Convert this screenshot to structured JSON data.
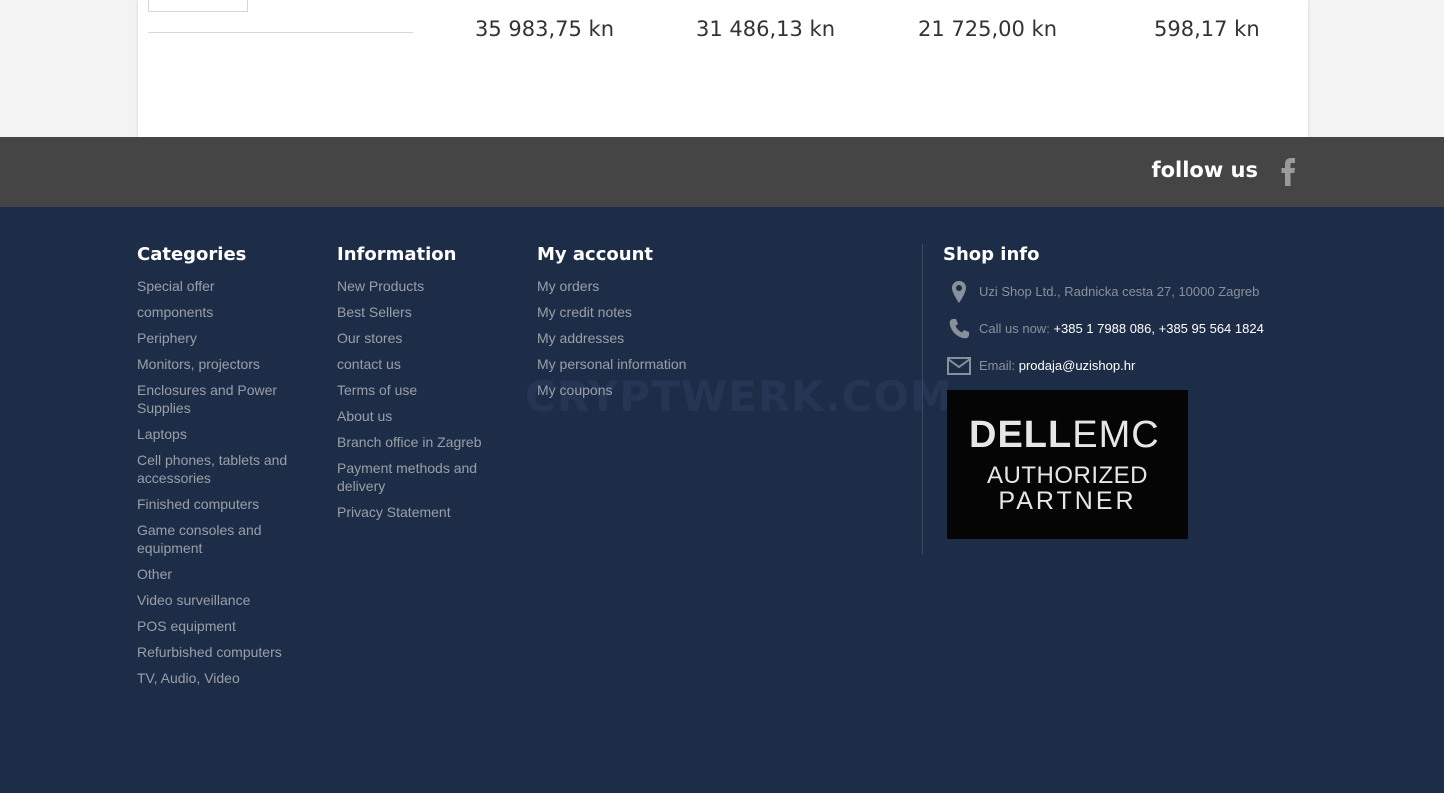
{
  "prices": [
    "35 983,75 kn",
    "31 486,13 kn",
    "21 725,00 kn",
    "598,17 kn"
  ],
  "follow": {
    "label": "follow us",
    "icon": "facebook-icon"
  },
  "footer": {
    "categories": {
      "title": "Categories",
      "items": [
        "Special offer",
        "components",
        "Periphery",
        "Monitors, projectors",
        "Enclosures and Power Supplies",
        "Laptops",
        "Cell phones, tablets and accessories",
        "Finished computers",
        "Game consoles and equipment",
        "Other",
        "Video surveillance",
        "POS equipment",
        "Refurbished computers",
        "TV, Audio, Video"
      ]
    },
    "information": {
      "title": "Information",
      "items": [
        "New Products",
        "Best Sellers",
        "Our stores",
        "contact us",
        "Terms of use",
        "About us",
        "Branch office in Zagreb",
        "Payment methods and delivery",
        "Privacy Statement"
      ]
    },
    "account": {
      "title": "My account",
      "items": [
        "My orders",
        "My credit notes",
        "My addresses",
        "My personal information",
        "My coupons"
      ]
    },
    "shop_info": {
      "title": "Shop info",
      "address": "Uzi Shop Ltd., Radnicka cesta 27, 10000 Zagreb",
      "phone_label": "Call us now:",
      "phone": "+385 1 7988 086, +385 95 564 1824",
      "email_label": "Email:",
      "email": "prodaja@uzishop.hr"
    },
    "badge": {
      "brand": "DELL",
      "brand2": "EMC",
      "line2": "AUTHORIZED",
      "line3": "PARTNER"
    },
    "watermark": "CRYPTWERK.COM"
  },
  "colors": {
    "footer_bg": "#1e2d47",
    "band_bg": "#454545",
    "link": "#9a9fa8"
  }
}
